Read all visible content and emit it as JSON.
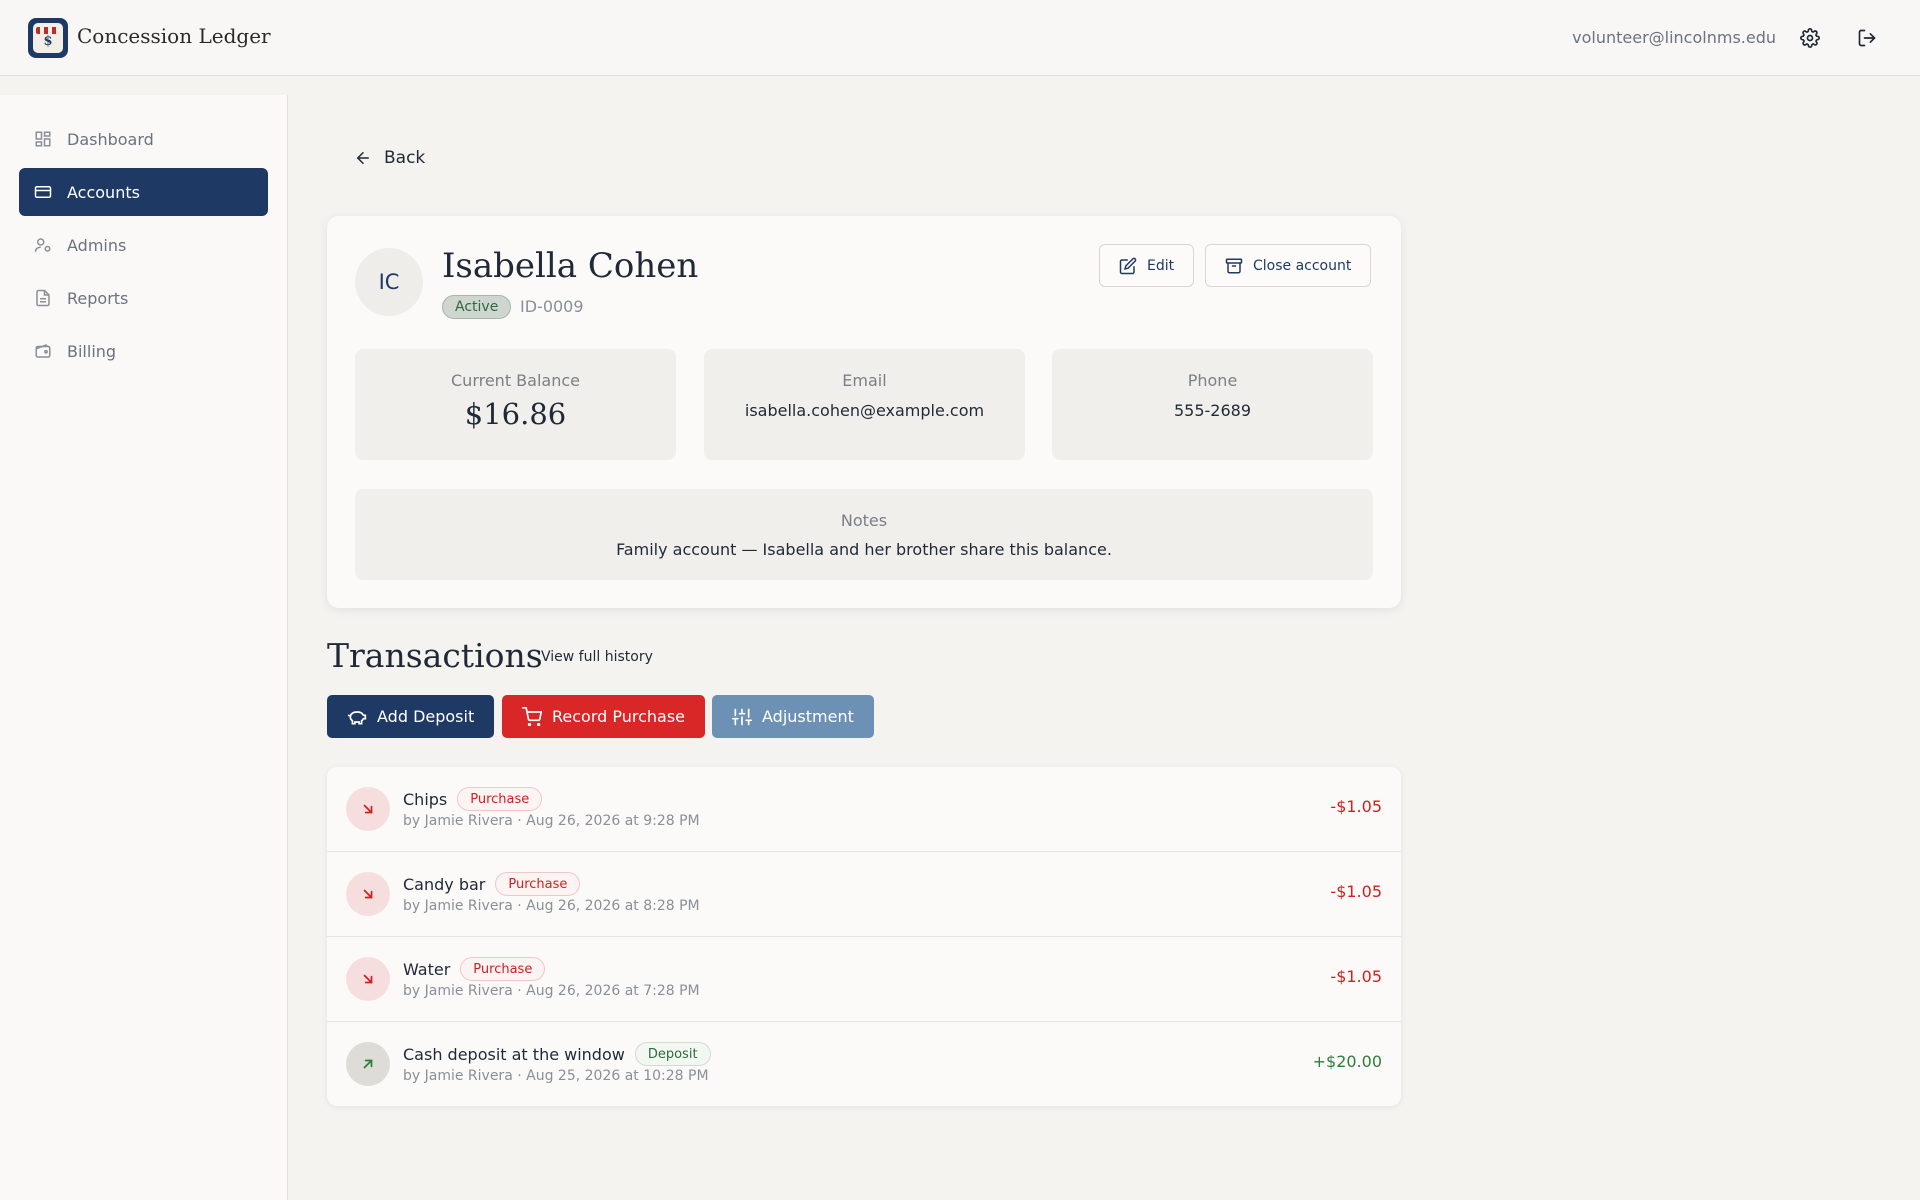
{
  "app": {
    "title": "Concession Ledger",
    "user_email": "volunteer@lincolnms.edu"
  },
  "sidebar": {
    "items": [
      {
        "label": "Dashboard",
        "icon": "dashboard-icon"
      },
      {
        "label": "Accounts",
        "icon": "card-icon",
        "active": true
      },
      {
        "label": "Admins",
        "icon": "admins-icon"
      },
      {
        "label": "Reports",
        "icon": "document-icon"
      },
      {
        "label": "Billing",
        "icon": "wallet-icon"
      }
    ]
  },
  "nav": {
    "back_label": "Back"
  },
  "account": {
    "initials": "IC",
    "name": "Isabella Cohen",
    "status": "Active",
    "id": "ID-0009",
    "edit_label": "Edit",
    "close_label": "Close account",
    "balance_label": "Current Balance",
    "balance": "$16.86",
    "email_label": "Email",
    "email": "isabella.cohen@example.com",
    "phone_label": "Phone",
    "phone": "555-2689",
    "notes_label": "Notes",
    "notes": "Family account — Isabella and her brother share this balance."
  },
  "transactions": {
    "heading": "Transactions",
    "history_link": "View full history",
    "buttons": {
      "deposit": "Add Deposit",
      "purchase": "Record Purchase",
      "adjustment": "Adjustment"
    },
    "items": [
      {
        "name": "Chips",
        "type": "Purchase",
        "meta": "by Jamie Rivera · Aug 26, 2026 at 9:28 PM",
        "amount": "-$1.05"
      },
      {
        "name": "Candy bar",
        "type": "Purchase",
        "meta": "by Jamie Rivera · Aug 26, 2026 at 8:28 PM",
        "amount": "-$1.05"
      },
      {
        "name": "Water",
        "type": "Purchase",
        "meta": "by Jamie Rivera · Aug 26, 2026 at 7:28 PM",
        "amount": "-$1.05"
      },
      {
        "name": "Cash deposit at the window",
        "type": "Deposit",
        "meta": "by Jamie Rivera · Aug 25, 2026 at 10:28 PM",
        "amount": "+$20.00"
      }
    ]
  },
  "colors": {
    "brand_navy": "#1e3a64",
    "danger_red": "#d92626",
    "adjust_blue": "#6d91b5",
    "positive_green": "#2e7d3a"
  }
}
